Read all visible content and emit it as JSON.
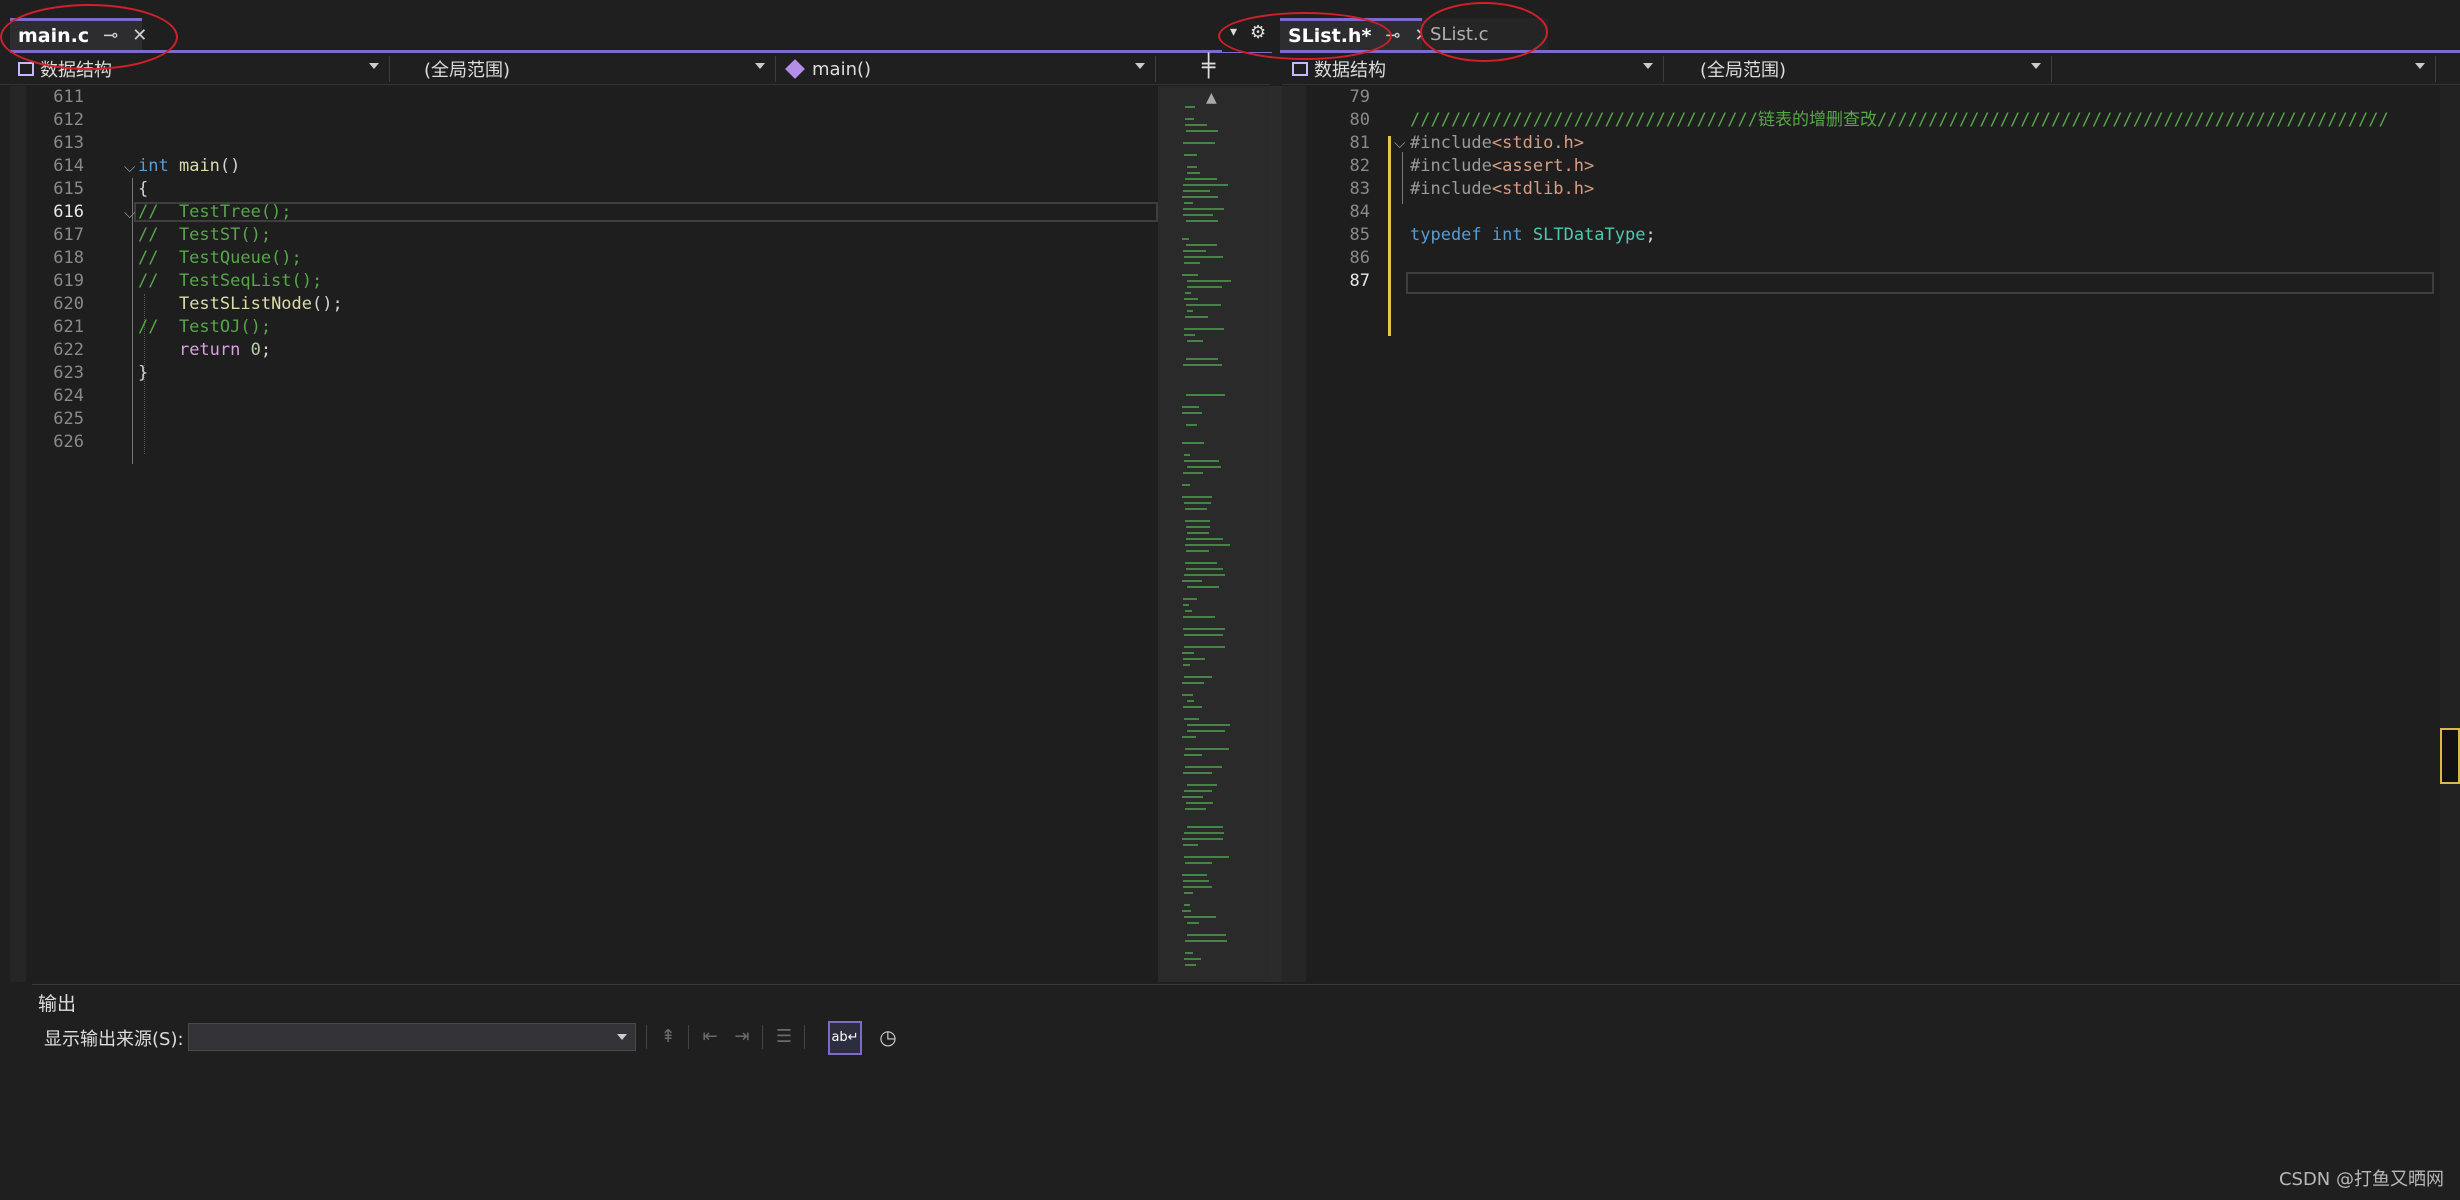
{
  "left_pane": {
    "tabs": [
      {
        "label": "main.c",
        "pin": "⊸",
        "close": "✕"
      }
    ],
    "nav": {
      "project": "数据结构",
      "scope": "(全局范围)",
      "member": "main()"
    },
    "split_icon": "split-icon",
    "lines": [
      {
        "n": "611",
        "html": ""
      },
      {
        "n": "612",
        "html": ""
      },
      {
        "n": "613",
        "html": ""
      },
      {
        "n": "614",
        "html": "<span class='kw'>int</span> <span class='fn'>main</span>()"
      },
      {
        "n": "615",
        "html": "{"
      },
      {
        "n": "616",
        "html": "<span class='cmt'>//  TestTree();</span>"
      },
      {
        "n": "617",
        "html": "<span class='cmt'>//  TestST();</span>"
      },
      {
        "n": "618",
        "html": "<span class='cmt'>//  TestQueue();</span>"
      },
      {
        "n": "619",
        "html": "<span class='cmt'>//  TestSeqList();</span>"
      },
      {
        "n": "620",
        "html": "    <span class='fn'>TestSListNode</span>();"
      },
      {
        "n": "621",
        "html": "<span class='cmt'>//  TestOJ();</span>"
      },
      {
        "n": "622",
        "html": "    <span class='ctrl'>return</span> <span class='num'>0</span>;"
      },
      {
        "n": "623",
        "html": "}"
      },
      {
        "n": "624",
        "html": ""
      },
      {
        "n": "625",
        "html": ""
      },
      {
        "n": "626",
        "html": ""
      }
    ],
    "current_line": "616"
  },
  "right_pane": {
    "tabs": [
      {
        "label": "SList.h*",
        "pin": "⊸",
        "close": "✕"
      },
      {
        "label": "SList.c"
      }
    ],
    "nav": {
      "project": "数据结构",
      "scope": "(全局范围)",
      "member": ""
    },
    "lines": [
      {
        "n": "79",
        "html": ""
      },
      {
        "n": "80",
        "html": "<span class='cmt'>//////////////////////////////////链表的增删查改//////////////////////////////////////////////////</span>"
      },
      {
        "n": "81",
        "html": "<span class='pp'>#include</span><span class='str'>&lt;stdio.h&gt;</span>"
      },
      {
        "n": "82",
        "html": "<span class='pp'>#include</span><span class='str'>&lt;assert.h&gt;</span>"
      },
      {
        "n": "83",
        "html": "<span class='pp'>#include</span><span class='str'>&lt;stdlib.h&gt;</span>"
      },
      {
        "n": "84",
        "html": ""
      },
      {
        "n": "85",
        "html": "<span class='kw'>typedef</span> <span class='kw'>int</span> <span class='type'>SLTDataType</span>;"
      },
      {
        "n": "86",
        "html": ""
      },
      {
        "n": "87",
        "html": ""
      }
    ],
    "current_line": "87"
  },
  "tab_controls": {
    "dropdown_icon": "chevron-down-icon",
    "settings_icon": "gear-icon"
  },
  "output": {
    "title": "输出",
    "source_label": "显示输出来源(S):",
    "source_value": ""
  },
  "watermark": "CSDN @打鱼又晒网",
  "colors": {
    "accent": "#7e6ac8",
    "annotation_red": "#d0202a"
  }
}
